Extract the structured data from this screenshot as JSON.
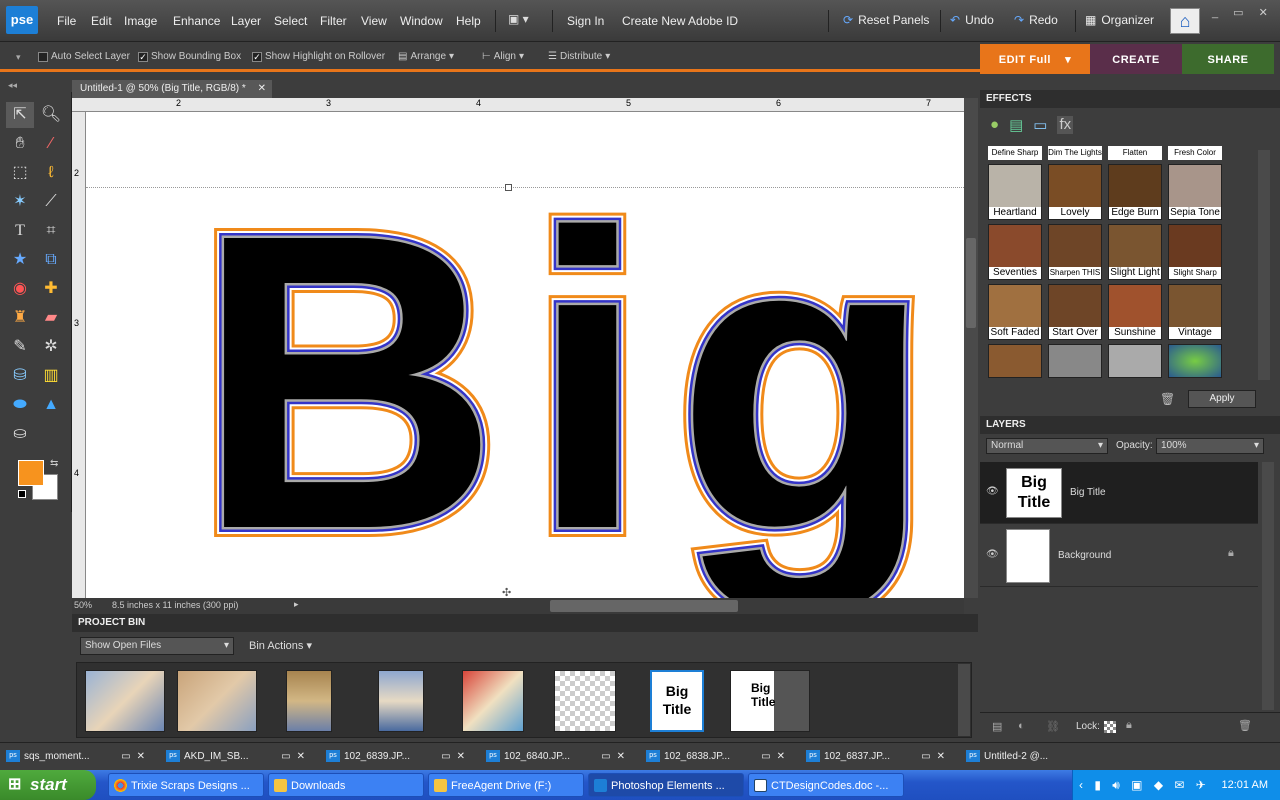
{
  "app": {
    "logo": "pse"
  },
  "menu": [
    "File",
    "Edit",
    "Image",
    "Enhance",
    "Layer",
    "Select",
    "Filter",
    "View",
    "Window",
    "Help"
  ],
  "toolbar": {
    "sign_in": "Sign In",
    "create_id": "Create New Adobe ID",
    "reset_panels": "Reset Panels",
    "undo": "Undo",
    "redo": "Redo",
    "organizer": "Organizer"
  },
  "options": {
    "auto_select": "Auto Select Layer",
    "show_bbox": "Show Bounding Box",
    "show_highlight": "Show Highlight on Rollover",
    "arrange": "Arrange",
    "align": "Align",
    "distribute": "Distribute"
  },
  "mode_tabs": {
    "edit": "EDIT Full",
    "create": "CREATE",
    "share": "SHARE"
  },
  "document": {
    "tab_title": "Untitled-1 @ 50% (Big  Title, RGB/8) *",
    "zoom": "50%",
    "size_info": "8.5 inches x 11 inches (300 ppi)",
    "canvas_text": "Big",
    "ruler_h": [
      "2",
      "3",
      "4",
      "5",
      "6",
      "7"
    ],
    "ruler_v": [
      "2",
      "3",
      "4"
    ]
  },
  "project_bin": {
    "title": "PROJECT BIN",
    "show": "Show Open Files",
    "actions": "Bin Actions",
    "thumb_text_1": "Big",
    "thumb_text_2": "Title"
  },
  "effects": {
    "title": "EFFECTS",
    "top_row": [
      "Define Sharp",
      "Dim The Lights",
      "Flatten",
      "Fresh Color"
    ],
    "rows": [
      [
        "Heartland",
        "Lovely",
        "Edge Burn",
        "Sepia Tone"
      ],
      [
        "Seventies",
        "Sharpen THIS",
        "Slight Light",
        "Slight Sharp"
      ],
      [
        "Soft Faded",
        "Start Over",
        "Sunshine",
        "Vintage"
      ]
    ],
    "apply": "Apply"
  },
  "layers": {
    "title": "LAYERS",
    "blend": "Normal",
    "opacity_label": "Opacity:",
    "opacity": "100%",
    "items": [
      {
        "name": "Big  Title",
        "thumb1": "Big",
        "thumb2": "Title"
      },
      {
        "name": "Background"
      }
    ],
    "lock_label": "Lock:"
  },
  "open_docs": [
    "sqs_moment...",
    "AKD_IM_SB...",
    "102_6839.JP...",
    "102_6840.JP...",
    "102_6838.JP...",
    "102_6837.JP...",
    "Untitled-2 @..."
  ],
  "taskbar": {
    "start": "start",
    "tasks": [
      "Trixie Scraps Designs ...",
      "Downloads",
      "FreeAgent Drive (F:)",
      "Photoshop Elements ...",
      "CTDesignCodes.doc -..."
    ],
    "clock": "12:01 AM"
  },
  "colors": {
    "accent": "#e8751a",
    "create": "#5a2e4a",
    "share": "#3d6b2d",
    "fg": "#f7931e",
    "bg": "#ffffff"
  }
}
